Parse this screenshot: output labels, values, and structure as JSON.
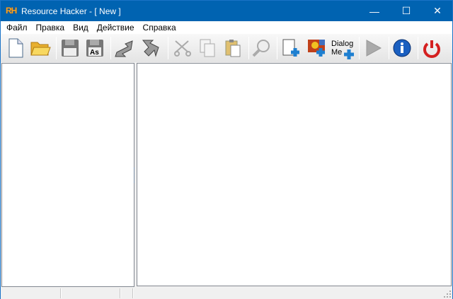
{
  "window": {
    "logo": "RH",
    "title": "Resource Hacker - [ New ]",
    "minimize": "—",
    "maximize": "☐",
    "close": "✕"
  },
  "menu": [
    "Файл",
    "Правка",
    "Вид",
    "Действие",
    "Справка"
  ],
  "toolbar": {
    "dialog_menu_line1": "Dialog",
    "dialog_menu_line2": "Me"
  },
  "colors": {
    "titlebar": "#0063b1",
    "accent_plus": "#1e7fd0",
    "power": "#d42020"
  }
}
